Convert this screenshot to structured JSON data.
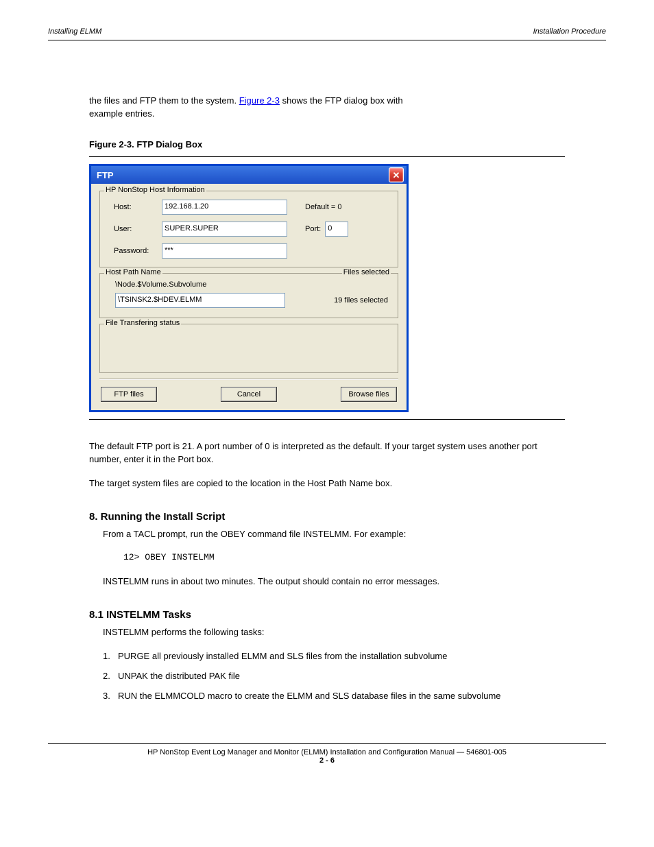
{
  "header": {
    "left": "Installing ELMM",
    "right": "Installation Procedure"
  },
  "intro": {
    "prefix": "the files and FTP them to the system. ",
    "link_text": "Figure 2-3",
    "after_link": " shows the FTP dialog box with",
    "line2": "example entries."
  },
  "figure_caption": "Figure 2-3. FTP Dialog Box",
  "dialog": {
    "title": "FTP",
    "group_host_legend": "HP NonStop Host Information",
    "host_label": "Host:",
    "host_value": "192.168.1.20",
    "user_label": "User:",
    "user_value": "SUPER.SUPER",
    "password_label": "Password:",
    "password_value": "***",
    "default_label": "Default = 0",
    "port_label": "Port:",
    "port_value": "0",
    "group_path_legend": "Host Path Name",
    "group_files_legend": "Files selected",
    "path_hint": "\\Node.$Volume.Subvolume",
    "path_value": "\\TSINSK2.$HDEV.ELMM",
    "files_selected": "19 files selected",
    "group_status_legend": "File Transfering status",
    "btn_ftp": "FTP files",
    "btn_cancel": "Cancel",
    "btn_browse": "Browse files"
  },
  "body": {
    "p1": "The default FTP port is 21. A port number of 0 is interpreted as the default. If your target system uses another port number, enter it in the Port box.",
    "p2": "The target system files are copied to the location in the Host Path Name box.",
    "sec8": "8. Running the Install Script",
    "p3": "From a TACL prompt, run the OBEY command file INSTELMM. For example:",
    "code1": "12> OBEY INSTELMM",
    "p4": "INSTELMM runs in about two minutes. The output should contain no error messages.",
    "sec8_1": "8.1 INSTELMM Tasks",
    "p5": "INSTELMM performs the following tasks:",
    "list": [
      {
        "n": "1.",
        "t": "PURGE all previously installed ELMM and SLS files from the installation subvolume"
      },
      {
        "n": "2.",
        "t": "UNPAK the distributed PAK file"
      },
      {
        "n": "3.",
        "t": "RUN the ELMMCOLD macro to create the ELMM and SLS database files in the same subvolume"
      }
    ]
  },
  "footer": {
    "left": "",
    "center_line1": "HP NonStop Event Log Manager and Monitor (ELMM) Installation and Configuration Manual — 546801-005",
    "center_line2": "2 - 6",
    "right": ""
  }
}
